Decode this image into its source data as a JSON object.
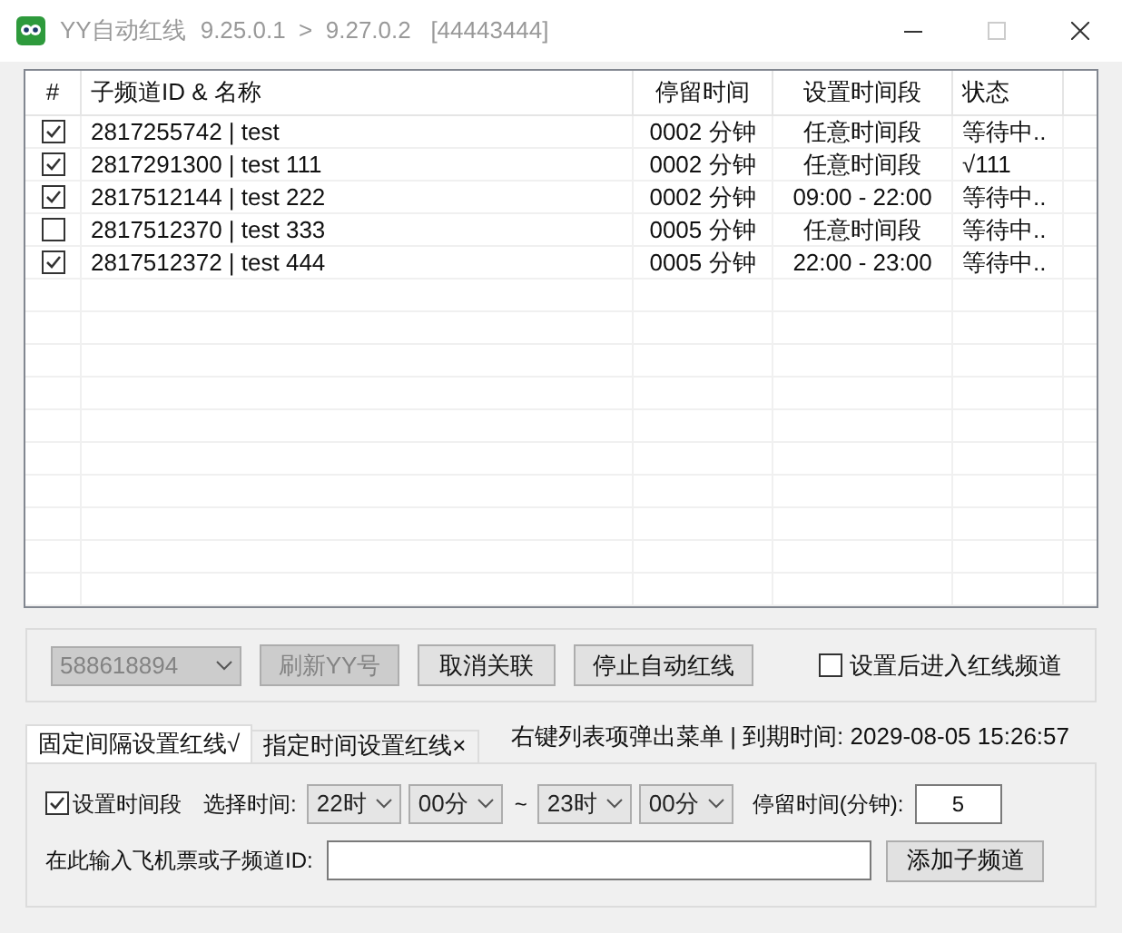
{
  "window": {
    "title": "YY自动红线",
    "version": "9.25.0.1  >  9.27.0.2   [44443444]"
  },
  "table": {
    "columns": [
      "#",
      "子频道ID & 名称",
      "停留时间",
      "设置时间段",
      "状态"
    ],
    "rows": [
      {
        "checked": true,
        "name": "2817255742 | test",
        "stay": "0002 分钟",
        "period": "任意时间段",
        "status": "等待中.."
      },
      {
        "checked": true,
        "name": "2817291300 | test 111",
        "stay": "0002 分钟",
        "period": "任意时间段",
        "status": "√111"
      },
      {
        "checked": true,
        "name": "2817512144 | test 222",
        "stay": "0002 分钟",
        "period": "09:00 - 22:00",
        "status": "等待中.."
      },
      {
        "checked": false,
        "name": "2817512370 | test 333",
        "stay": "0005 分钟",
        "period": "任意时间段",
        "status": "等待中.."
      },
      {
        "checked": true,
        "name": "2817512372 | test 444",
        "stay": "0005 分钟",
        "period": "22:00 - 23:00",
        "status": "等待中.."
      }
    ]
  },
  "controls": {
    "account": {
      "value": "588618894",
      "disabled": true
    },
    "refresh_button": {
      "label": "刷新YY号",
      "disabled": true
    },
    "unlink_button": "取消关联",
    "stop_button": "停止自动红线",
    "enter_after": {
      "label": "设置后进入红线频道",
      "checked": false
    }
  },
  "tabs": [
    {
      "label": "固定间隔设置红线√",
      "selected": true
    },
    {
      "label": "指定时间设置红线×",
      "selected": false
    }
  ],
  "info": "右键列表项弹出菜单 | 到期时间: 2029-08-05 15:26:57",
  "panel": {
    "use_period": {
      "label": "设置时间段",
      "checked": true
    },
    "time_label": "选择时间:",
    "start_hour": "22时",
    "start_minute": "00分",
    "tilde": "~",
    "end_hour": "23时",
    "end_minute": "00分",
    "stay_label": "停留时间(分钟):",
    "stay_value": "5",
    "id_label": "在此输入飞机票或子频道ID:",
    "add_button": "添加子频道"
  }
}
